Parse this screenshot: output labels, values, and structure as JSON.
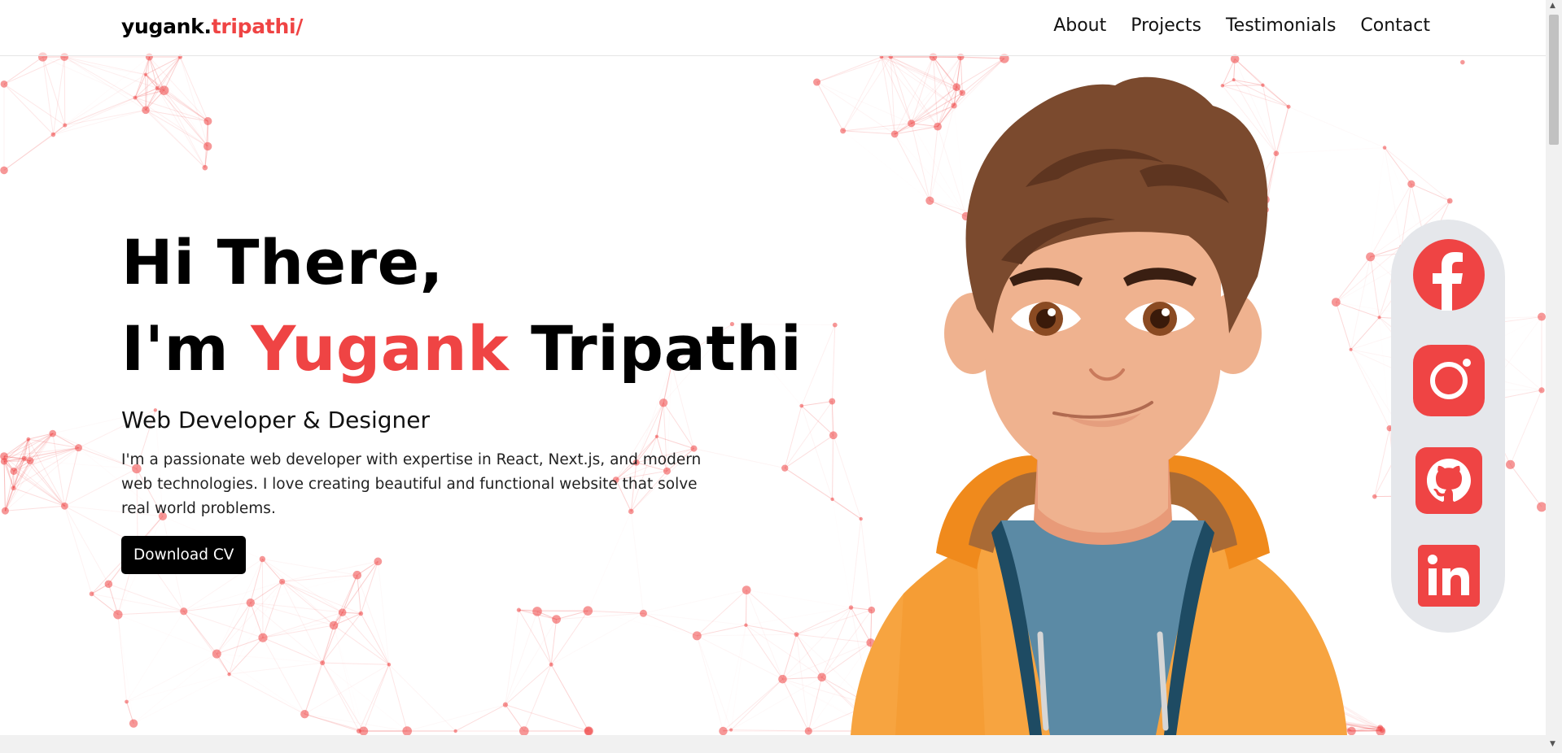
{
  "brand": {
    "name": "yugank.",
    "accent": "tripathi/"
  },
  "nav": [
    "About",
    "Projects",
    "Testimonials",
    "Contact"
  ],
  "hero": {
    "line1": "Hi There,",
    "im": "I'm",
    "first_name": "Yugank",
    "last_name": "Tripathi",
    "subtitle": "Web Developer & Designer",
    "description": "I'm a passionate web developer with expertise in React, Next.js, and modern web technologies. I love creating beautiful and functional website that solve real world problems.",
    "button": "Download CV"
  },
  "social": [
    {
      "name": "facebook",
      "icon": "facebook-icon"
    },
    {
      "name": "instagram",
      "icon": "instagram-icon"
    },
    {
      "name": "github",
      "icon": "github-icon"
    },
    {
      "name": "linkedin",
      "icon": "linkedin-icon"
    }
  ],
  "colors": {
    "accent": "#ef4444",
    "hoodie": "#f7a440",
    "hair": "#7b4a2e",
    "shirt": "#5b8aa5",
    "panel": "#e5e7eb"
  }
}
